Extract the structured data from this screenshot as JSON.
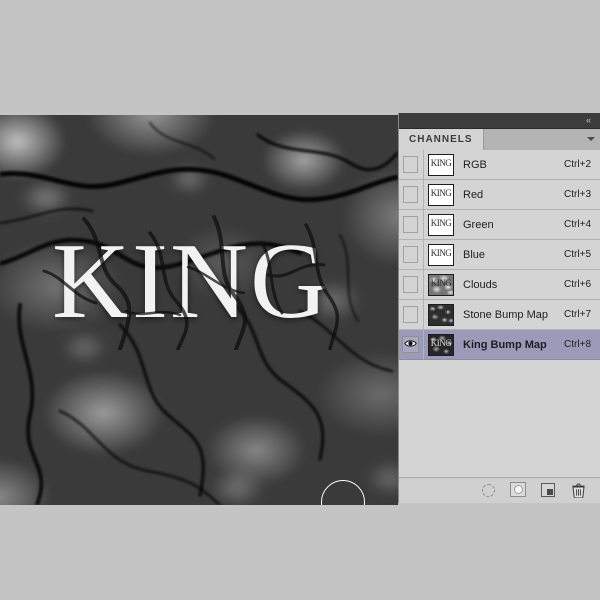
{
  "canvas": {
    "artwork_text": "KING",
    "brush_cursor": {
      "name": "brush-circle-cursor",
      "diameter": 44
    }
  },
  "panel": {
    "collapse_icon": "«",
    "tab_label": "CHANNELS",
    "menu_icon": "panel-menu-arrow",
    "thumbnail_text": "KING",
    "rows": [
      {
        "name": "RGB",
        "shortcut": "Ctrl+2",
        "visible": false,
        "selected": false,
        "thumb": "king"
      },
      {
        "name": "Red",
        "shortcut": "Ctrl+3",
        "visible": false,
        "selected": false,
        "thumb": "king"
      },
      {
        "name": "Green",
        "shortcut": "Ctrl+4",
        "visible": false,
        "selected": false,
        "thumb": "king"
      },
      {
        "name": "Blue",
        "shortcut": "Ctrl+5",
        "visible": false,
        "selected": false,
        "thumb": "king"
      },
      {
        "name": "Clouds",
        "shortcut": "Ctrl+6",
        "visible": false,
        "selected": false,
        "thumb": "cloudy"
      },
      {
        "name": "Stone Bump Map",
        "shortcut": "Ctrl+7",
        "visible": false,
        "selected": false,
        "thumb": "stone"
      },
      {
        "name": "King Bump Map",
        "shortcut": "Ctrl+8",
        "visible": true,
        "selected": true,
        "thumb": "kingbump"
      }
    ],
    "bottom_buttons": [
      {
        "icon": "load-channel-as-selection-icon"
      },
      {
        "icon": "save-selection-as-channel-icon"
      },
      {
        "icon": "new-channel-icon"
      },
      {
        "icon": "delete-channel-icon"
      }
    ]
  },
  "colors": {
    "app_background": "#c4c4c4",
    "panel_background": "#d4d4d4",
    "panel_titlebar": "#3c3c3c",
    "panel_tabbar": "#b4b4b4",
    "row_selected": "#9b9bb9",
    "text": "#1e1e1e"
  }
}
